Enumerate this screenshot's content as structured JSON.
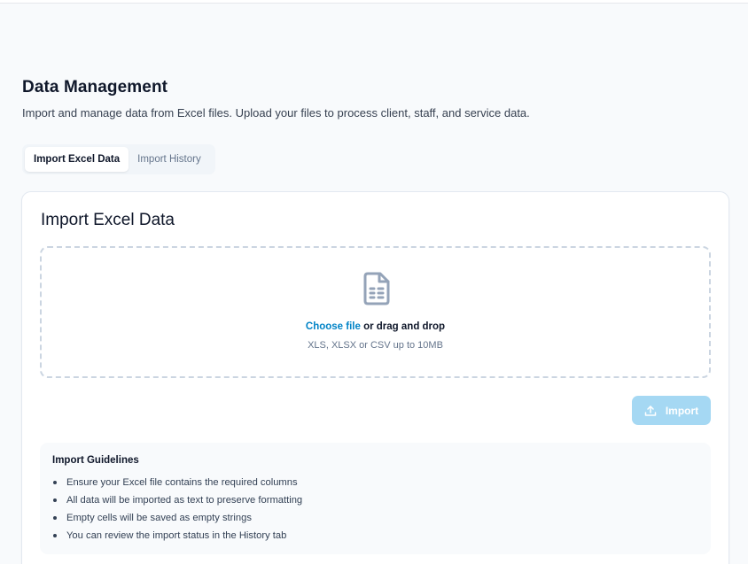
{
  "header": {
    "title": "Data Management",
    "subtitle": "Import and manage data from Excel files. Upload your files to process client, staff, and service data."
  },
  "tabs": [
    {
      "label": "Import Excel Data",
      "active": true
    },
    {
      "label": "Import History",
      "active": false
    }
  ],
  "import_card": {
    "title": "Import Excel Data",
    "dropzone": {
      "icon": "file-spreadsheet-icon",
      "choose_label": "Choose file",
      "drag_label": " or drag and drop",
      "hint": "XLS, XLSX or CSV up to 10MB"
    },
    "import_button": {
      "label": "Import",
      "icon": "upload-icon",
      "disabled": true
    },
    "guidelines": {
      "title": "Import Guidelines",
      "items": [
        "Ensure your Excel file contains the required columns",
        "All data will be imported as text to preserve formatting",
        "Empty cells will be saved as empty strings",
        "You can review the import status in the History tab"
      ]
    }
  },
  "colors": {
    "accent": "#0284c7",
    "button_disabled": "#a5d8f3",
    "page_background": "#f8fafc"
  }
}
